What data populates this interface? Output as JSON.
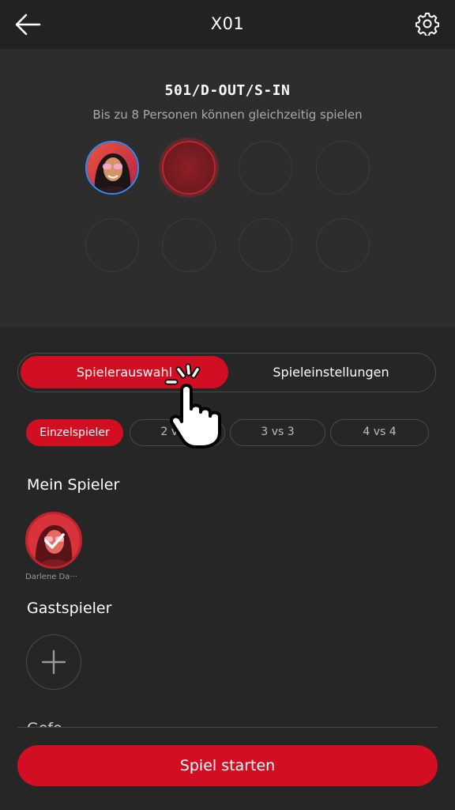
{
  "header": {
    "title": "X01",
    "back_icon": "arrow-left-icon",
    "settings_icon": "gear-icon"
  },
  "game": {
    "mode": "501/D-OUT/S-IN",
    "subtitle": "Bis zu 8 Personen können gleichzeitig spielen",
    "slots_total": 8,
    "slots_filled": 1,
    "active_slot": 2
  },
  "tabs": [
    {
      "label": "Spielerauswahl",
      "selected": true
    },
    {
      "label": "Spieleinstellungen",
      "selected": false
    }
  ],
  "teams": [
    {
      "label": "Einzelspieler",
      "selected": true
    },
    {
      "label": "2 vs 2",
      "selected": false
    },
    {
      "label": "3 vs 3",
      "selected": false
    },
    {
      "label": "4 vs 4",
      "selected": false
    }
  ],
  "my_player": {
    "heading": "Mein Spieler",
    "name": "Darlene Da···",
    "checked": true
  },
  "guest": {
    "heading": "Gastspieler",
    "add_icon": "plus-icon"
  },
  "next_section_partial": "Gefo...",
  "start_button": "Spiel starten",
  "colors": {
    "accent": "#d20f22",
    "avatar_ring": "#2d8cff",
    "background": "#262626"
  }
}
